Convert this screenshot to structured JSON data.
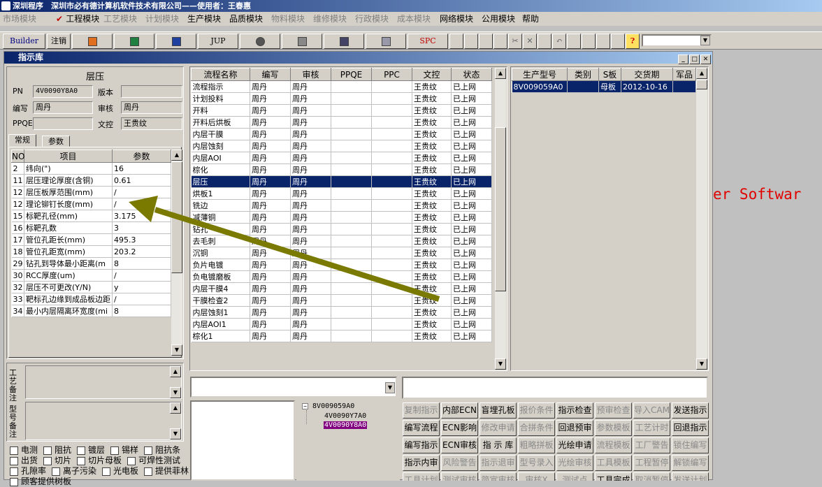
{
  "app": {
    "title": "深圳程序　深圳市必有德计算机软件技术有限公司——使用者：王春惠",
    "bg_text": "er Softwar"
  },
  "menu": [
    "市场模块",
    "工程模块",
    "工艺模块",
    "计划模块",
    "生产模块",
    "品质模块",
    "物料模块",
    "维修模块",
    "行政模块",
    "成本模块",
    "网络模块",
    "公用模块",
    "帮助"
  ],
  "menu_disabled": [
    0,
    2,
    3,
    6,
    7,
    8,
    9
  ],
  "toolbar": {
    "builder": "Builder",
    "logout": "注销",
    "jup": "JUP",
    "spc": "SPC"
  },
  "window": {
    "title": "指示库"
  },
  "left": {
    "header": "层压",
    "pn_label": "PN",
    "pn_value": "4V0090Y8A0",
    "version_label": "版本",
    "version_value": "",
    "editor_label": "编写",
    "editor_value": "周丹",
    "reviewer_label": "审核",
    "reviewer_value": "周丹",
    "ppqe_label": "PPQE",
    "ppqe_value": "",
    "doc_label": "文控",
    "doc_value": "王贵纹",
    "tabs": [
      "常规",
      "参数"
    ],
    "param_headers": [
      "NO",
      "项目",
      "参数"
    ],
    "params": [
      [
        "2",
        "纬向(\")",
        "16"
      ],
      [
        "11",
        "层压理论厚度(含铜)",
        "0.61"
      ],
      [
        "12",
        "层压板厚范围(mm)",
        "/"
      ],
      [
        "12",
        "理论铆钉长度(mm)",
        "/"
      ],
      [
        "15",
        "标靶孔径(mm)",
        "3.175"
      ],
      [
        "16",
        "标靶孔数",
        "3"
      ],
      [
        "17",
        "管位孔距长(mm)",
        "495.3"
      ],
      [
        "18",
        "管位孔距宽(mm)",
        "203.2"
      ],
      [
        "29",
        "钻孔到导体最小距离(m",
        "8"
      ],
      [
        "30",
        "RCC厚度(um)",
        "/"
      ],
      [
        "32",
        "层压不可更改(Y/N)",
        "y"
      ],
      [
        "33",
        "靶标孔边缘到成品板边距",
        "/"
      ],
      [
        "34",
        "最小内层隔离环宽度(mi",
        "8"
      ]
    ],
    "remark1_label": "工艺备注",
    "remark2_label": "型号备注",
    "checkbox_rows": [
      [
        "电测",
        "阻抗",
        "镀层",
        "锡样",
        "阻抗条"
      ],
      [
        "出货",
        "切片",
        "切片母板",
        "可焊性测试"
      ],
      [
        "孔隙率",
        "离子污染",
        "光电板",
        "提供菲林"
      ],
      [
        "顾客提供树板"
      ]
    ]
  },
  "flow": {
    "headers": [
      "流程名称",
      "编写",
      "审核",
      "PPQE",
      "PPC",
      "文控",
      "状态"
    ],
    "rows": [
      [
        "流程指示",
        "周丹",
        "周丹",
        "",
        "",
        "王贵纹",
        "已上网"
      ],
      [
        "计划投料",
        "周丹",
        "周丹",
        "",
        "",
        "王贵纹",
        "已上网"
      ],
      [
        "开料",
        "周丹",
        "周丹",
        "",
        "",
        "王贵纹",
        "已上网"
      ],
      [
        "开料后烘板",
        "周丹",
        "周丹",
        "",
        "",
        "王贵纹",
        "已上网"
      ],
      [
        "内层干膜",
        "周丹",
        "周丹",
        "",
        "",
        "王贵纹",
        "已上网"
      ],
      [
        "内层蚀刻",
        "周丹",
        "周丹",
        "",
        "",
        "王贵纹",
        "已上网"
      ],
      [
        "内层AOI",
        "周丹",
        "周丹",
        "",
        "",
        "王贵纹",
        "已上网"
      ],
      [
        "棕化",
        "周丹",
        "周丹",
        "",
        "",
        "王贵纹",
        "已上网"
      ],
      [
        "层压",
        "周丹",
        "周丹",
        "",
        "",
        "王贵纹",
        "已上网"
      ],
      [
        "烘板1",
        "周丹",
        "周丹",
        "",
        "",
        "王贵纹",
        "已上网"
      ],
      [
        "铣边",
        "周丹",
        "周丹",
        "",
        "",
        "王贵纹",
        "已上网"
      ],
      [
        "减薄铜",
        "周丹",
        "周丹",
        "",
        "",
        "王贵纹",
        "已上网"
      ],
      [
        "钻孔",
        "周丹",
        "周丹",
        "",
        "",
        "王贵纹",
        "已上网"
      ],
      [
        "去毛刺",
        "周丹",
        "周丹",
        "",
        "",
        "王贵纹",
        "已上网"
      ],
      [
        "沉铜",
        "周丹",
        "周丹",
        "",
        "",
        "王贵纹",
        "已上网"
      ],
      [
        "负片电镀",
        "周丹",
        "周丹",
        "",
        "",
        "王贵纹",
        "已上网"
      ],
      [
        "负电镀磨板",
        "周丹",
        "周丹",
        "",
        "",
        "王贵纹",
        "已上网"
      ],
      [
        "内层干膜4",
        "周丹",
        "周丹",
        "",
        "",
        "王贵纹",
        "已上网"
      ],
      [
        "干膜检查2",
        "周丹",
        "周丹",
        "",
        "",
        "王贵纹",
        "已上网"
      ],
      [
        "内层蚀刻1",
        "周丹",
        "周丹",
        "",
        "",
        "王贵纹",
        "已上网"
      ],
      [
        "内层AOI1",
        "周丹",
        "周丹",
        "",
        "",
        "王贵纹",
        "已上网"
      ],
      [
        "棕化1",
        "周丹",
        "周丹",
        "",
        "",
        "王贵纹",
        "已上网"
      ]
    ],
    "selected": 8
  },
  "orders": {
    "headers": [
      "生产型号",
      "类别",
      "S板",
      "交货期",
      "军品"
    ],
    "rows": [
      [
        "8V009059A0",
        "",
        "母板",
        "2012-10-16",
        ""
      ]
    ]
  },
  "tree": {
    "root": "8V009059A0",
    "children": [
      "4V0090Y7A0",
      "4V0090Y8A0"
    ]
  },
  "actions": [
    [
      "复制指示",
      "内部ECN",
      "盲埋孔板",
      "报价条件",
      "指示检查",
      "预审检查",
      "导入CAM",
      "发送指示"
    ],
    [
      "编写流程",
      "ECN影响",
      "修改申请",
      "合拼条件",
      "回退预审",
      "参数模板",
      "工艺计时",
      "回退指示"
    ],
    [
      "编写指示",
      "ECN审核",
      "指 示 库",
      "粗略拼板",
      "光绘申请",
      "流程模板",
      "工厂警告",
      "锁住编写"
    ],
    [
      "指示内审",
      "风险警告",
      "指示退审",
      "型号录入",
      "光绘审核",
      "工具模板",
      "工程暂停",
      "解锁编写"
    ],
    [
      "工具计划",
      "测试审核",
      "简宣审核",
      "审核X",
      "测试点",
      "工具完成",
      "取消暂停",
      "发送计划"
    ]
  ],
  "actions_enabled": [
    [
      0,
      1,
      1,
      0,
      1,
      0,
      0,
      1
    ],
    [
      1,
      1,
      0,
      0,
      1,
      0,
      0,
      1
    ],
    [
      1,
      1,
      1,
      0,
      1,
      0,
      0,
      0
    ],
    [
      1,
      0,
      0,
      0,
      0,
      0,
      0,
      0
    ],
    [
      0,
      0,
      0,
      0,
      0,
      1,
      0,
      0
    ]
  ]
}
